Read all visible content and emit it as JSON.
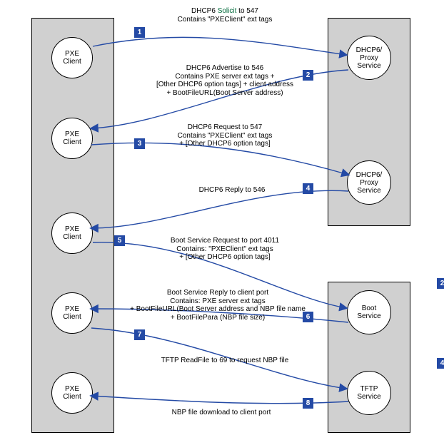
{
  "clients": {
    "c1": "PXE\nClient",
    "c2": "PXE\nClient",
    "c3": "PXE\nClient",
    "c4": "PXE\nClient",
    "c5": "PXE\nClient"
  },
  "services": {
    "dhcp1": "DHCP6/\nProxy\nService",
    "dhcp2": "DHCP6/\nProxy\nService",
    "boot": "Boot\nService",
    "tftp": "TFTP\nService"
  },
  "numbers": {
    "n1": "1",
    "n2": "2",
    "n3": "3",
    "n4": "4",
    "n5": "5",
    "n6": "6",
    "n7": "7",
    "n8": "8",
    "n2b": "2",
    "n4b": "4"
  },
  "messages": {
    "m1a": "DHCP6 ",
    "m1b": "Solicit",
    "m1c": " to 547",
    "m1d": "Contains \"PXEClient\" ext tags",
    "m2": "DHCP6 Advertise to 546\nContains PXE server ext tags +\n[Other DHCP6 option tags] + client address\n+ BootFileURL(Boot Server address)",
    "m3": "DHCP6 Request to 547\nContains \"PXEClient\" ext tags\n+ [Other DHCP6 option tags]",
    "m4": "DHCP6 Reply to 546",
    "m5": "Boot Service Request to port 4011\nContains: \"PXEClient\" ext tags\n+ [Other DHCP6 option tags]",
    "m6": "Boot Service Reply to client port\nContains: PXE server ext tags\n+ BootFileURL(Boot Server address and NBP file name\n+ BootFilePara (NBP file size)",
    "m7": "TFTP ReadFile to 69 to request NBP file",
    "m8": "NBP file download to client port"
  }
}
